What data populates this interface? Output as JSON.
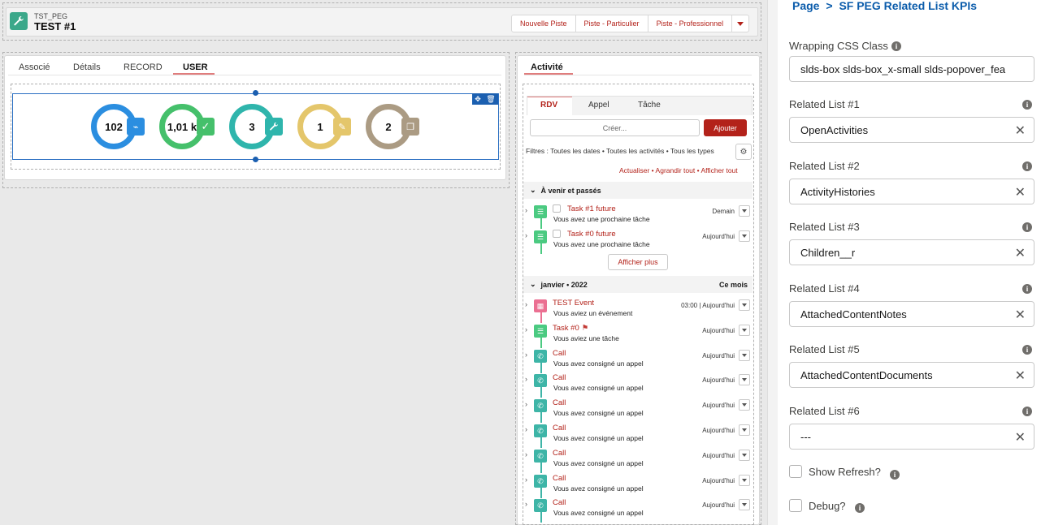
{
  "record": {
    "object_label": "TST_PEG",
    "title": "TEST #1"
  },
  "actions": [
    "Nouvelle Piste",
    "Piste - Particulier",
    "Piste - Professionnel"
  ],
  "left_tabs": [
    "Associé",
    "Détails",
    "RECORD",
    "USER"
  ],
  "kpis": [
    {
      "value": "102",
      "color": "#2b8ee0",
      "icon": "event-icon"
    },
    {
      "value": "1,01 k",
      "color": "#45c06b",
      "icon": "task-icon"
    },
    {
      "value": "3",
      "color": "#2fb5ac",
      "icon": "wrench-icon"
    },
    {
      "value": "1",
      "color": "#e4c66b",
      "icon": "note-icon"
    },
    {
      "value": "2",
      "color": "#ab9b83",
      "icon": "document-icon"
    }
  ],
  "activity": {
    "tab": "Activité",
    "publisher_tabs": [
      "RDV",
      "Appel",
      "Tâche"
    ],
    "create_placeholder": "Créer...",
    "add_button": "Ajouter",
    "filters": "Filtres : Toutes les dates • Toutes les activités • Tous les types",
    "links": "Actualiser • Agrandir tout • Afficher tout",
    "upcoming_section": "À venir et passés",
    "show_more": "Afficher plus",
    "month_section": "janvier • 2022",
    "month_right": "Ce mois",
    "upcoming": [
      {
        "title": "Task #1 future",
        "sub": "Vous avez une prochaine tâche",
        "date": "Demain"
      },
      {
        "title": "Task #0 future",
        "sub": "Vous avez une prochaine tâche",
        "date": "Aujourd'hui"
      }
    ],
    "past": [
      {
        "title": "TEST Event",
        "sub": "Vous aviez un événement",
        "date": "03:00 | Aujourd'hui",
        "kind": "event"
      },
      {
        "title": "Task #0",
        "sub": "Vous aviez une tâche",
        "date": "Aujourd'hui",
        "kind": "task"
      },
      {
        "title": "Call",
        "sub": "Vous avez consigné un appel",
        "date": "Aujourd'hui",
        "kind": "call"
      },
      {
        "title": "Call",
        "sub": "Vous avez consigné un appel",
        "date": "Aujourd'hui",
        "kind": "call"
      },
      {
        "title": "Call",
        "sub": "Vous avez consigné un appel",
        "date": "Aujourd'hui",
        "kind": "call"
      },
      {
        "title": "Call",
        "sub": "Vous avez consigné un appel",
        "date": "Aujourd'hui",
        "kind": "call"
      },
      {
        "title": "Call",
        "sub": "Vous avez consigné un appel",
        "date": "Aujourd'hui",
        "kind": "call"
      },
      {
        "title": "Call",
        "sub": "Vous avez consigné un appel",
        "date": "Aujourd'hui",
        "kind": "call"
      },
      {
        "title": "Call",
        "sub": "Vous avez consigné un appel",
        "date": "Aujourd'hui",
        "kind": "call"
      }
    ]
  },
  "panel": {
    "breadcrumb_root": "Page",
    "breadcrumb_sep": ">",
    "breadcrumb_current": "SF PEG Related List KPIs",
    "wrapping_label": "Wrapping CSS Class",
    "wrapping_value": "slds-box slds-box_x-small  slds-popover_fea",
    "related": [
      {
        "label": "Related List #1",
        "value": "OpenActivities"
      },
      {
        "label": "Related List #2",
        "value": "ActivityHistories"
      },
      {
        "label": "Related List #3",
        "value": "Children__r"
      },
      {
        "label": "Related List #4",
        "value": "AttachedContentNotes"
      },
      {
        "label": "Related List #5",
        "value": "AttachedContentDocuments"
      },
      {
        "label": "Related List #6",
        "value": "---"
      }
    ],
    "show_refresh": "Show Refresh?",
    "debug": "Debug?"
  },
  "colors": {
    "brand_red": "#b3221a",
    "link_blue": "#0b5cab",
    "task_green": "#4bca81",
    "call_teal": "#3eb5a7",
    "event_pink": "#eb7092"
  }
}
